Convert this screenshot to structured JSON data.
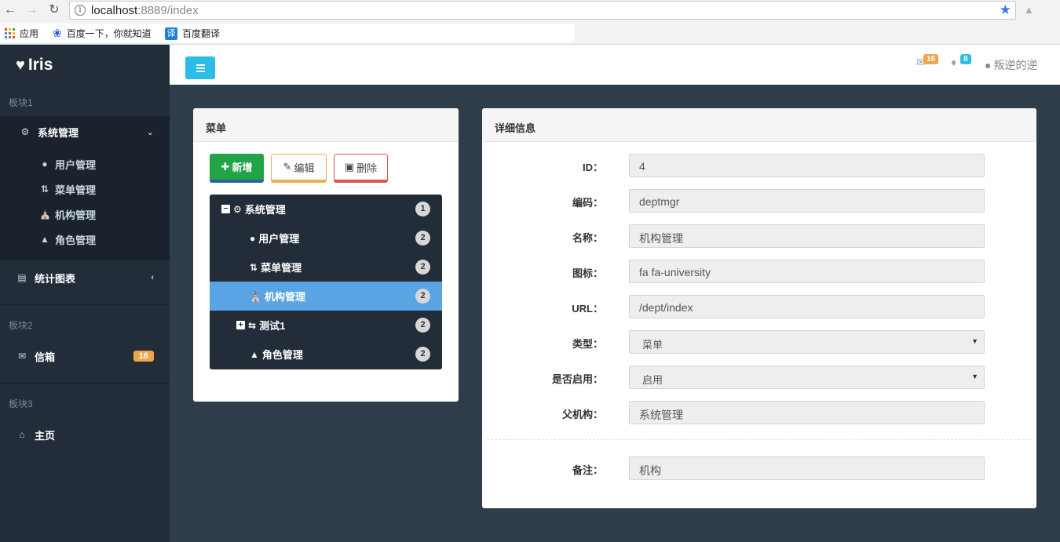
{
  "browser": {
    "url_host": "localhost",
    "url_rest": ":8889/index",
    "bookmarks": [
      "应用",
      "百度一下，你就知道",
      "百度翻译"
    ],
    "translate_glyph": "译"
  },
  "sidebar": {
    "brand": "Iris",
    "section1": "板块1",
    "system_menu": {
      "label": "系统管理",
      "items": [
        {
          "label": "用户管理",
          "icon": "user-icon"
        },
        {
          "label": "菜单管理",
          "icon": "sort-icon"
        },
        {
          "label": "机构管理",
          "icon": "university-icon"
        },
        {
          "label": "角色管理",
          "icon": "user-secret-icon"
        }
      ]
    },
    "stats": "统计图表",
    "section2": "板块2",
    "mail": {
      "label": "信箱",
      "badge": "16"
    },
    "section3": "板块3",
    "home": "主页"
  },
  "header": {
    "mail_badge": "16",
    "bell_badge": "8",
    "user_name": "叛逆的逆",
    "colors": {
      "toggle": "#2bbde6",
      "mail_badge": "#f0a44a",
      "bell_badge": "#2bbde6"
    }
  },
  "menu_panel": {
    "title": "菜单",
    "add_label": "新增",
    "edit_label": "编辑",
    "delete_label": "删除",
    "tree": [
      {
        "label": "系统管理",
        "count": "1",
        "toggle": "−",
        "icon": "cogs-icon"
      },
      {
        "label": "用户管理",
        "count": "2",
        "icon": "user-icon"
      },
      {
        "label": "菜单管理",
        "count": "2",
        "icon": "sort-icon"
      },
      {
        "label": "机构管理",
        "count": "2",
        "icon": "university-icon",
        "active": true
      },
      {
        "label": "测试1",
        "count": "2",
        "toggle": "+",
        "icon": "exchange-icon"
      },
      {
        "label": "角色管理",
        "count": "2",
        "icon": "user-secret-icon"
      }
    ]
  },
  "detail_panel": {
    "title": "详细信息",
    "fields": {
      "id": {
        "label": "ID：",
        "value": "4"
      },
      "code": {
        "label": "编码：",
        "value": "deptmgr"
      },
      "name": {
        "label": "名称：",
        "value": "机构管理"
      },
      "icon": {
        "label": "图标：",
        "value": "fa fa-university"
      },
      "url": {
        "label": "URL：",
        "value": "/dept/index"
      },
      "type": {
        "label": "类型：",
        "value": "菜单"
      },
      "enabled": {
        "label": "是否启用：",
        "value": "启用"
      },
      "parent": {
        "label": "父机构：",
        "value": "系统管理"
      },
      "remark": {
        "label": "备注：",
        "value": "机构"
      }
    }
  }
}
